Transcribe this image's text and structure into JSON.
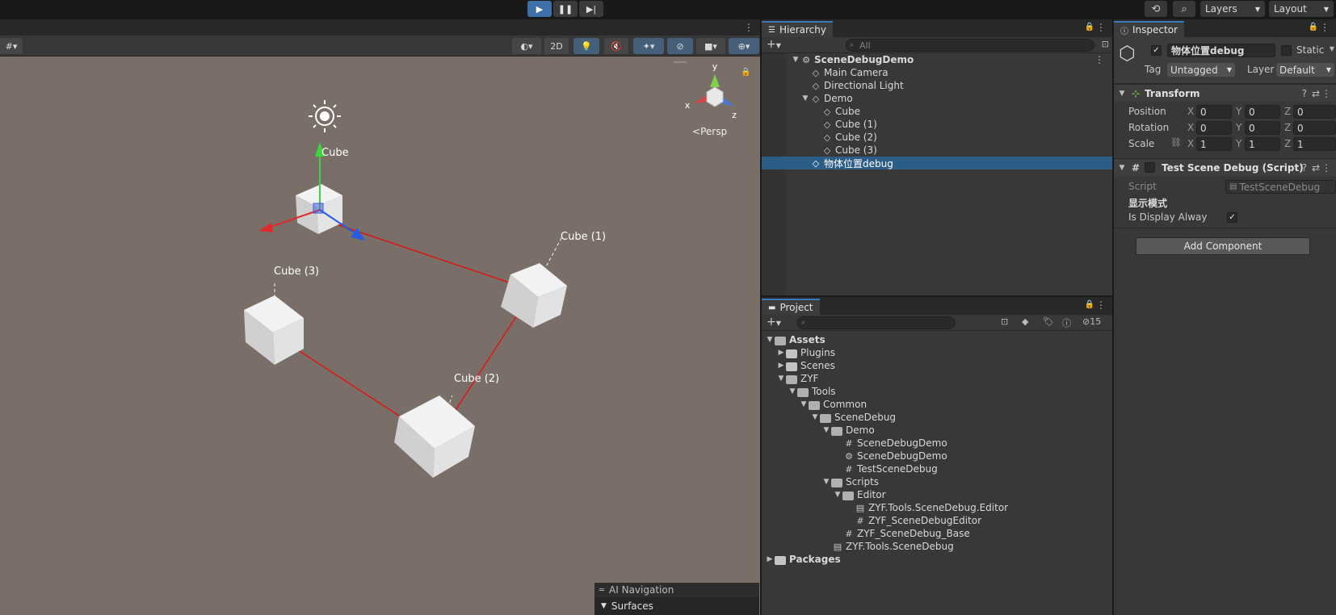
{
  "toolbar": {
    "play_icon": "play-icon",
    "pause_icon": "pause-icon",
    "step_icon": "step-icon",
    "layers_label": "Layers",
    "layout_label": "Layout"
  },
  "scene_view": {
    "toolbar_2d_label": "2D",
    "persp_label": "Persp",
    "gizmo_axes": {
      "x": "x",
      "y": "y",
      "z": "z"
    },
    "object_labels": {
      "cube": "Cube",
      "cube1": "Cube (1)",
      "cube2": "Cube (2)",
      "cube3": "Cube (3)"
    },
    "overlay": {
      "title": "AI Navigation",
      "item": "Surfaces"
    }
  },
  "hierarchy": {
    "tab_label": "Hierarchy",
    "search_placeholder": "All",
    "items": [
      {
        "label": "SceneDebugDemo",
        "bold": true
      },
      {
        "label": "Main Camera"
      },
      {
        "label": "Directional Light"
      },
      {
        "label": "Demo"
      },
      {
        "label": "Cube"
      },
      {
        "label": "Cube (1)"
      },
      {
        "label": "Cube (2)"
      },
      {
        "label": "Cube (3)"
      },
      {
        "label": "物体位置debug",
        "selected": true
      }
    ]
  },
  "project": {
    "tab_label": "Project",
    "hidden_count": "15",
    "items": [
      {
        "label": "Assets"
      },
      {
        "label": "Plugins"
      },
      {
        "label": "Scenes"
      },
      {
        "label": "ZYF"
      },
      {
        "label": "Tools"
      },
      {
        "label": "Common"
      },
      {
        "label": "SceneDebug"
      },
      {
        "label": "Demo"
      },
      {
        "label": "SceneDebugDemo"
      },
      {
        "label": "SceneDebugDemo"
      },
      {
        "label": "TestSceneDebug"
      },
      {
        "label": "Scripts"
      },
      {
        "label": "Editor"
      },
      {
        "label": "ZYF.Tools.SceneDebug.Editor"
      },
      {
        "label": "ZYF_SceneDebugEditor"
      },
      {
        "label": "ZYF_SceneDebug_Base"
      },
      {
        "label": "ZYF.Tools.SceneDebug"
      },
      {
        "label": "Packages"
      }
    ]
  },
  "inspector": {
    "tab_label": "Inspector",
    "object_name": "物体位置debug",
    "static_label": "Static",
    "tag_label": "Tag",
    "tag_value": "Untagged",
    "layer_label": "Layer",
    "layer_value": "Default",
    "transform": {
      "title": "Transform",
      "position_label": "Position",
      "rotation_label": "Rotation",
      "scale_label": "Scale",
      "axis_x": "X",
      "axis_y": "Y",
      "axis_z": "Z",
      "position": [
        "0",
        "0",
        "0"
      ],
      "rotation": [
        "0",
        "0",
        "0"
      ],
      "scale": [
        "1",
        "1",
        "1"
      ]
    },
    "script_component": {
      "title": "Test Scene Debug (Script)",
      "script_label": "Script",
      "script_value": "TestSceneDebug",
      "section_header": "显示模式",
      "display_label": "Is Display Alway",
      "display_checked": "✓"
    },
    "add_component_label": "Add Component"
  },
  "colors": {
    "accent": "#3a79bb",
    "selected_row": "#2c5d87",
    "viewport_bg": "#796f68",
    "debug_line": "#e01515"
  }
}
